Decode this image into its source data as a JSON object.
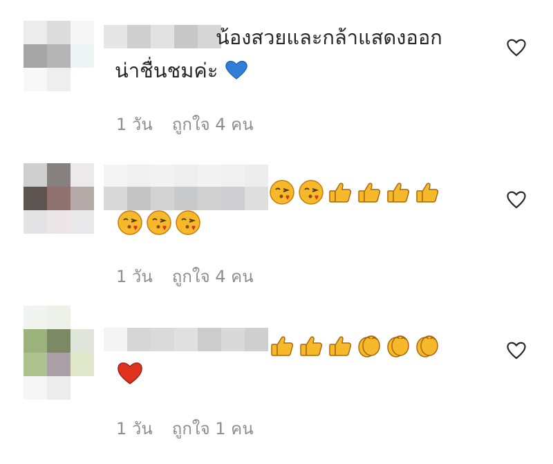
{
  "comments": [
    {
      "text_line1": "น้องสวยและกล้าแสดงออก",
      "text_line2": "น่าชื่นชมค่ะ",
      "trailing_emoji": "blue-heart",
      "time": "1 วัน",
      "likes": "ถูกใจ 4 คน"
    },
    {
      "emojis_line1": [
        "kissing-heart",
        "kissing-heart",
        "thumbs-up",
        "thumbs-up",
        "thumbs-up",
        "thumbs-up"
      ],
      "emojis_line2": [
        "kissing-heart",
        "kissing-heart",
        "kissing-heart"
      ],
      "time": "1 วัน",
      "likes": "ถูกใจ 4 คน"
    },
    {
      "emojis_line1": [
        "thumbs-up",
        "thumbs-up",
        "thumbs-up",
        "clapping-hands",
        "clapping-hands",
        "clapping-hands"
      ],
      "emojis_line2": [
        "red-heart"
      ],
      "time": "1 วัน",
      "likes": "ถูกใจ 1 คน"
    }
  ],
  "colors": {
    "text": "#262626",
    "meta": "#8e8e8e",
    "emoji_yellow": "#f6b92b",
    "blue_heart": "#2f7fd8",
    "red_heart": "#e0301e"
  }
}
